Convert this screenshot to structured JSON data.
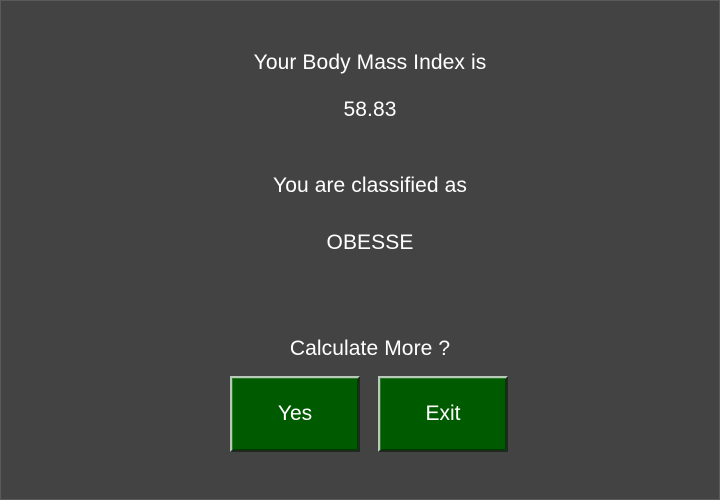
{
  "result": {
    "bmi_heading": "Your Body Mass Index is",
    "bmi_value": "58.83",
    "class_heading": "You are classified as",
    "class_value": "OBESSE"
  },
  "prompt": {
    "question": "Calculate More ?",
    "yes_label": "Yes",
    "exit_label": "Exit"
  },
  "colors": {
    "background": "#434343",
    "button_fill": "#005a00",
    "text": "#ffffff"
  }
}
